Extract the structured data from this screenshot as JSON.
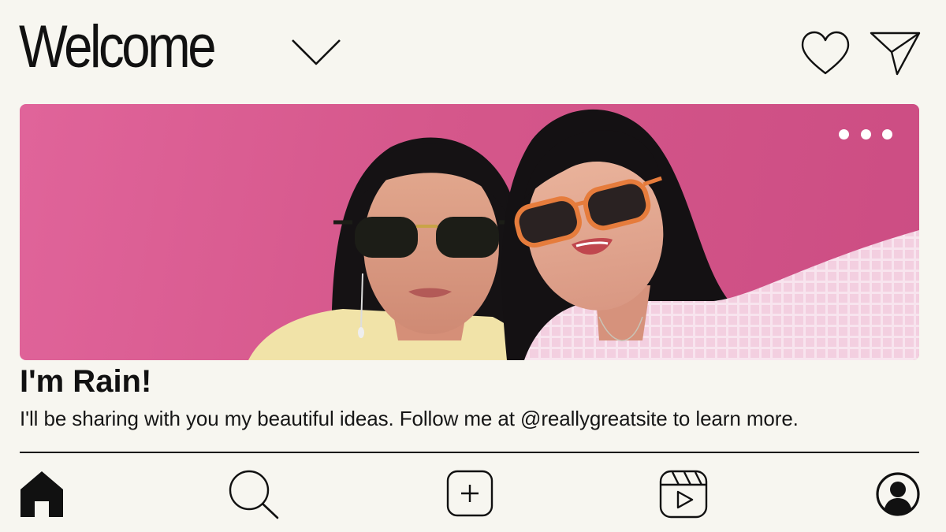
{
  "header": {
    "title": "Welcome",
    "icons": {
      "dropdown": "chevron-down-icon",
      "notifications": "heart-icon",
      "messages": "paper-plane-icon"
    }
  },
  "banner": {
    "more_icon": "more-horizontal-icon",
    "background_color": "#d5578b"
  },
  "profile": {
    "name": "I'm Rain!",
    "bio": "I'll be sharing with you my beautiful ideas. Follow me at @reallygreatsite to learn more."
  },
  "bottom_nav": {
    "items": [
      {
        "icon": "home-icon",
        "active": true
      },
      {
        "icon": "search-icon",
        "active": false
      },
      {
        "icon": "add-post-icon",
        "active": false
      },
      {
        "icon": "reels-icon",
        "active": false
      },
      {
        "icon": "profile-icon",
        "active": false
      }
    ]
  },
  "colors": {
    "background": "#f7f6f0",
    "foreground": "#111111",
    "accent_pink": "#d5578b"
  }
}
